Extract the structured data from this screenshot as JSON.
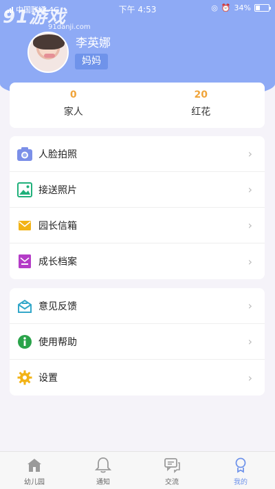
{
  "status_bar": {
    "carrier": "中国联通",
    "network": "4G",
    "time": "下午 4:53",
    "battery_text": "34%",
    "battery_level": 0.34
  },
  "watermark": {
    "big": "91游戏",
    "small": "91danji.com"
  },
  "profile": {
    "name": "李英娜",
    "role": "妈妈"
  },
  "stats": [
    {
      "value": "0",
      "label": "家人"
    },
    {
      "value": "20",
      "label": "红花"
    }
  ],
  "menu_group_1": [
    {
      "label": "人脸拍照",
      "icon": "camera-icon",
      "color": "#7b8fe8"
    },
    {
      "label": "接送照片",
      "icon": "photo-icon",
      "color": "#1fb07a"
    },
    {
      "label": "园长信箱",
      "icon": "mail-icon",
      "color": "#f2b316"
    },
    {
      "label": "成长档案",
      "icon": "archive-icon",
      "color": "#b43cc7"
    }
  ],
  "menu_group_2": [
    {
      "label": "意见反馈",
      "icon": "feedback-icon",
      "color": "#32a7c9"
    },
    {
      "label": "使用帮助",
      "icon": "info-icon",
      "color": "#2aa34a"
    },
    {
      "label": "设置",
      "icon": "gear-icon",
      "color": "#f2b316"
    }
  ],
  "tabs": [
    {
      "label": "幼儿园",
      "icon": "home-icon",
      "active": false
    },
    {
      "label": "通知",
      "icon": "bell-icon",
      "active": false
    },
    {
      "label": "交流",
      "icon": "chat-icon",
      "active": false
    },
    {
      "label": "我的",
      "icon": "profile-icon",
      "active": true
    }
  ],
  "colors": {
    "header": "#8eaaf5",
    "accent": "#6f93ea",
    "stat_number": "#f0a43a"
  }
}
